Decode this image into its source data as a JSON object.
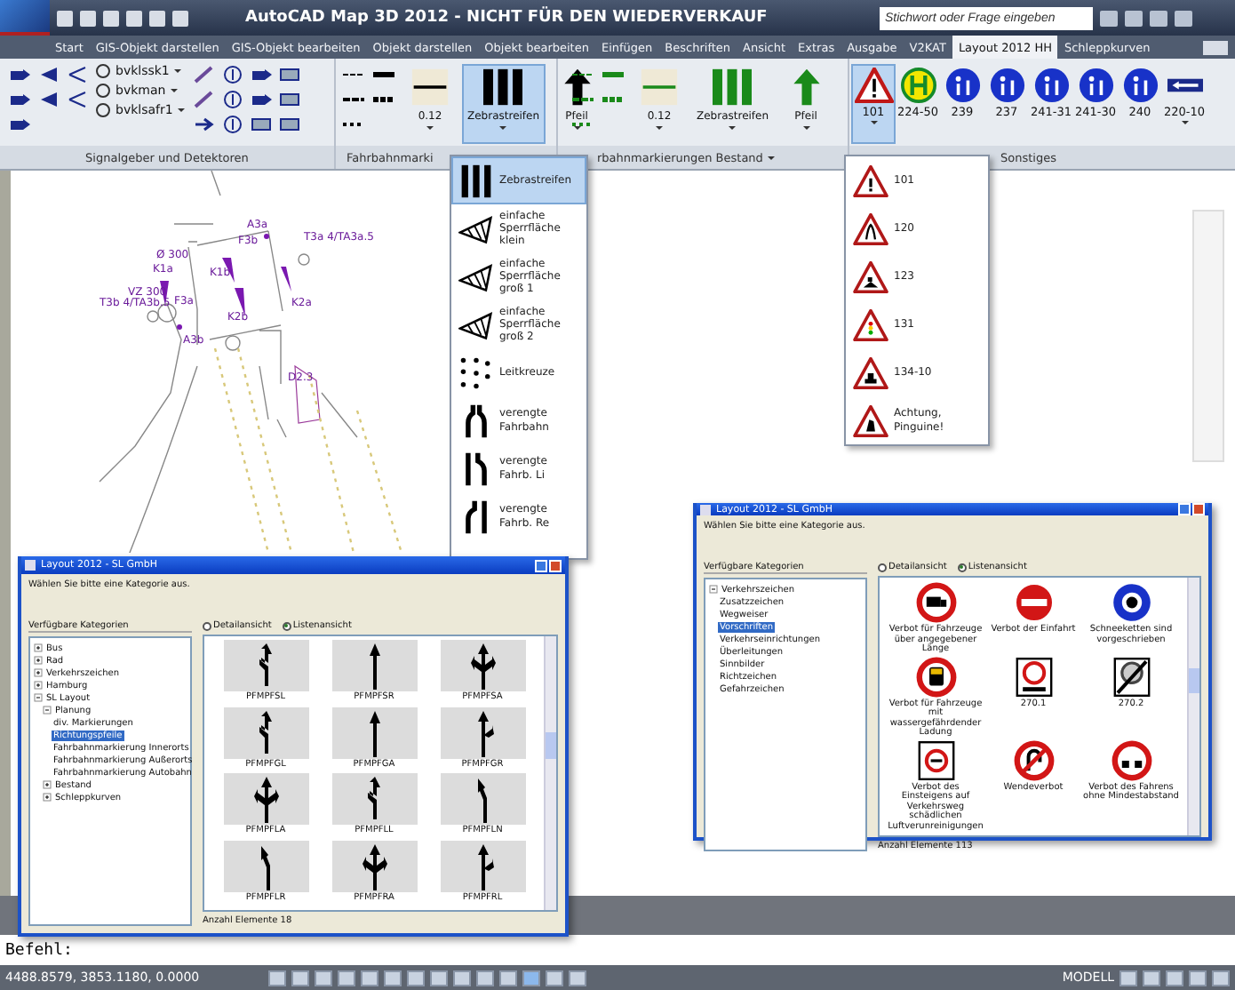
{
  "window": {
    "title": "AutoCAD Map 3D 2012 - NICHT FÜR DEN WIEDERVERKAUF",
    "search_placeholder": "Stichwort oder Frage eingeben"
  },
  "tabs": [
    {
      "label": "Start",
      "selected": false
    },
    {
      "label": "GIS-Objekt darstellen",
      "selected": false
    },
    {
      "label": "GIS-Objekt bearbeiten",
      "selected": false
    },
    {
      "label": "Objekt darstellen",
      "selected": false
    },
    {
      "label": "Objekt bearbeiten",
      "selected": false
    },
    {
      "label": "Einfügen",
      "selected": false
    },
    {
      "label": "Beschriften",
      "selected": false
    },
    {
      "label": "Ansicht",
      "selected": false
    },
    {
      "label": "Extras",
      "selected": false
    },
    {
      "label": "Ausgabe",
      "selected": false
    },
    {
      "label": "V2KAT",
      "selected": false
    },
    {
      "label": "Layout 2012 HH",
      "selected": true
    },
    {
      "label": "Schleppkurven",
      "selected": false
    }
  ],
  "ribbon": {
    "signals": {
      "label": "Signalgeber und Detektoren",
      "dropdowns": [
        {
          "value": "bvklssk1"
        },
        {
          "value": "bvkman"
        },
        {
          "value": "bvklsafr1"
        }
      ]
    },
    "markings": {
      "label": "Fahrbahnmarki",
      "color": "#000000",
      "buttons": [
        {
          "kind": "line",
          "label": "0.12",
          "selected": false
        },
        {
          "kind": "zebra",
          "label": "Zebrastreifen",
          "selected": true
        },
        {
          "kind": "arrow",
          "label": "Pfeil",
          "selected": false
        }
      ]
    },
    "existing": {
      "label": "rbahnmarkierungen Bestand",
      "color": "#1a8a1a",
      "buttons": [
        {
          "kind": "line",
          "label": "0.12",
          "selected": false
        },
        {
          "kind": "zebra",
          "label": "Zebrastreifen",
          "selected": false
        },
        {
          "kind": "arrow",
          "label": "Pfeil",
          "selected": false
        }
      ]
    },
    "misc": {
      "label": "Sonstiges",
      "signs": [
        {
          "kind": "warning",
          "label": "101",
          "selected": true
        },
        {
          "kind": "busstop",
          "label": "224-50",
          "selected": false
        },
        {
          "kind": "blue",
          "label": "239",
          "selected": false
        },
        {
          "kind": "blue",
          "label": "237",
          "selected": false
        },
        {
          "kind": "blue",
          "label": "241-31",
          "selected": false
        },
        {
          "kind": "blue",
          "label": "241-30",
          "selected": false
        },
        {
          "kind": "blue",
          "label": "240",
          "selected": false
        },
        {
          "kind": "plate",
          "label": "220-10",
          "selected": false
        }
      ]
    }
  },
  "marking_menu": [
    {
      "kind": "zebra",
      "label": "Zebrastreifen",
      "selected": true
    },
    {
      "kind": "hatch",
      "label": "einfache Sperrfläche klein",
      "selected": false
    },
    {
      "kind": "hatch",
      "label": "einfache Sperrfläche groß 1",
      "selected": false
    },
    {
      "kind": "hatch",
      "label": "einfache Sperrfläche groß 2",
      "selected": false
    },
    {
      "kind": "crosses",
      "label": "Leitkreuze",
      "selected": false
    },
    {
      "kind": "narrow",
      "label": "verengte Fahrbahn",
      "selected": false
    },
    {
      "kind": "narrowleft",
      "label": "verengte Fahrb. Li",
      "selected": false
    },
    {
      "kind": "narrowright",
      "label": "verengte Fahrb. Re",
      "selected": false
    }
  ],
  "sign_menu": [
    {
      "label": "101",
      "selected": false
    },
    {
      "label": "120",
      "selected": false
    },
    {
      "label": "123",
      "selected": false
    },
    {
      "label": "131",
      "selected": false
    },
    {
      "label": "134-10",
      "selected": false
    },
    {
      "label": "Achtung, Pinguine!",
      "selected": false
    }
  ],
  "drawing": {
    "labels": [
      "A3a",
      "F3b",
      "T3a 4/TA3a.5",
      "Ø 300",
      "K1a",
      "K1b",
      "K2a",
      "VZ 300",
      "T3b 4/TA3b.5",
      "F3a",
      "A3b",
      "K2b",
      "D2.3"
    ]
  },
  "dialogs": [
    {
      "title": "Layout 2012 - SL GmbH",
      "prompt": "Wählen Sie bitte eine Kategorie aus.",
      "tree_label": "Verfügbare Kategorien",
      "views": [
        {
          "label": "Detailansicht",
          "selected": false
        },
        {
          "label": "Listenansicht",
          "selected": true
        }
      ],
      "tree": [
        {
          "label": "Bus",
          "expanded": false,
          "selected": false
        },
        {
          "label": "Rad",
          "expanded": false,
          "selected": false
        },
        {
          "label": "Verkehrszeichen",
          "expanded": false,
          "selected": false
        },
        {
          "label": "Hamburg",
          "expanded": false,
          "selected": false
        },
        {
          "label": "SL Layout",
          "expanded": true,
          "selected": false,
          "children": [
            {
              "label": "Planung",
              "expanded": true,
              "selected": false,
              "children": [
                {
                  "label": "div. Markierungen",
                  "selected": false
                },
                {
                  "label": "Richtungspfeile",
                  "selected": true
                },
                {
                  "label": "Fahrbahnmarkierung Innerorts",
                  "selected": false
                },
                {
                  "label": "Fahrbahnmarkierung Außerorts",
                  "selected": false
                },
                {
                  "label": "Fahrbahnmarkierung Autobahn",
                  "selected": false
                }
              ]
            },
            {
              "label": "Bestand",
              "expanded": false,
              "selected": false
            },
            {
              "label": "Schleppkurven",
              "expanded": false,
              "selected": false
            }
          ]
        }
      ],
      "items": [
        {
          "kind": "left",
          "label": "PFMPFSL"
        },
        {
          "kind": "straight",
          "label": "PFMPFSR"
        },
        {
          "kind": "split",
          "label": "PFMPFSA"
        },
        {
          "kind": "left",
          "label": "PFMPFGL"
        },
        {
          "kind": "straight",
          "label": "PFMPFGA"
        },
        {
          "kind": "right",
          "label": "PFMPFGR"
        },
        {
          "kind": "split",
          "label": "PFMPFLA"
        },
        {
          "kind": "left",
          "label": "PFMPFLL"
        },
        {
          "kind": "turn",
          "label": "PFMPFLN"
        },
        {
          "kind": "turn",
          "label": "PFMPFLR"
        },
        {
          "kind": "split",
          "label": "PFMPFRA"
        },
        {
          "kind": "right",
          "label": "PFMPFRL"
        }
      ],
      "count": "Anzahl Elemente 18"
    },
    {
      "title": "Layout 2012 - SL GmbH",
      "prompt": "Wählen Sie bitte eine Kategorie aus.",
      "tree_label": "Verfügbare Kategorien",
      "views": [
        {
          "label": "Detailansicht",
          "selected": false
        },
        {
          "label": "Listenansicht",
          "selected": true
        }
      ],
      "tree": [
        {
          "label": "Verkehrszeichen",
          "expanded": true,
          "selected": false,
          "children": [
            {
              "label": "Zusatzzeichen",
              "selected": false
            },
            {
              "label": "Wegweiser",
              "selected": false
            },
            {
              "label": "Vorschriften",
              "selected": true
            },
            {
              "label": "Verkehrseinrichtungen",
              "selected": false
            },
            {
              "label": "Überleitungen",
              "selected": false
            },
            {
              "label": "Sinnbilder",
              "selected": false
            },
            {
              "label": "Richtzeichen",
              "selected": false
            },
            {
              "label": "Gefahrzeichen",
              "selected": false
            }
          ]
        }
      ],
      "items": [
        {
          "kind": "truck",
          "label": "Verbot für Fahrzeuge über angegebener Länge"
        },
        {
          "kind": "noentry",
          "label": "Verbot der Einfahrt"
        },
        {
          "kind": "blue",
          "label": "Schneeketten sind vorgeschrieben"
        },
        {
          "kind": "tanker",
          "label": "Verbot für Fahrzeuge mit wassergefährdender Ladung"
        },
        {
          "kind": "zone",
          "label": "270.1"
        },
        {
          "kind": "zoneend",
          "label": "270.2"
        },
        {
          "kind": "framed",
          "label": "Verbot des Einsteigens auf Verkehrsweg schädlichen Luftverunreinigungen"
        },
        {
          "kind": "uturn",
          "label": "Wendeverbot"
        },
        {
          "kind": "distance",
          "label": "Verbot des Fahrens ohne Mindestabstand"
        }
      ],
      "count": "Anzahl Elemente 113"
    }
  ],
  "command_line": {
    "prompt": "Befehl:"
  },
  "status_bar": {
    "coordinates": "4488.8579, 3853.1180, 0.0000",
    "space": "MODELL"
  }
}
